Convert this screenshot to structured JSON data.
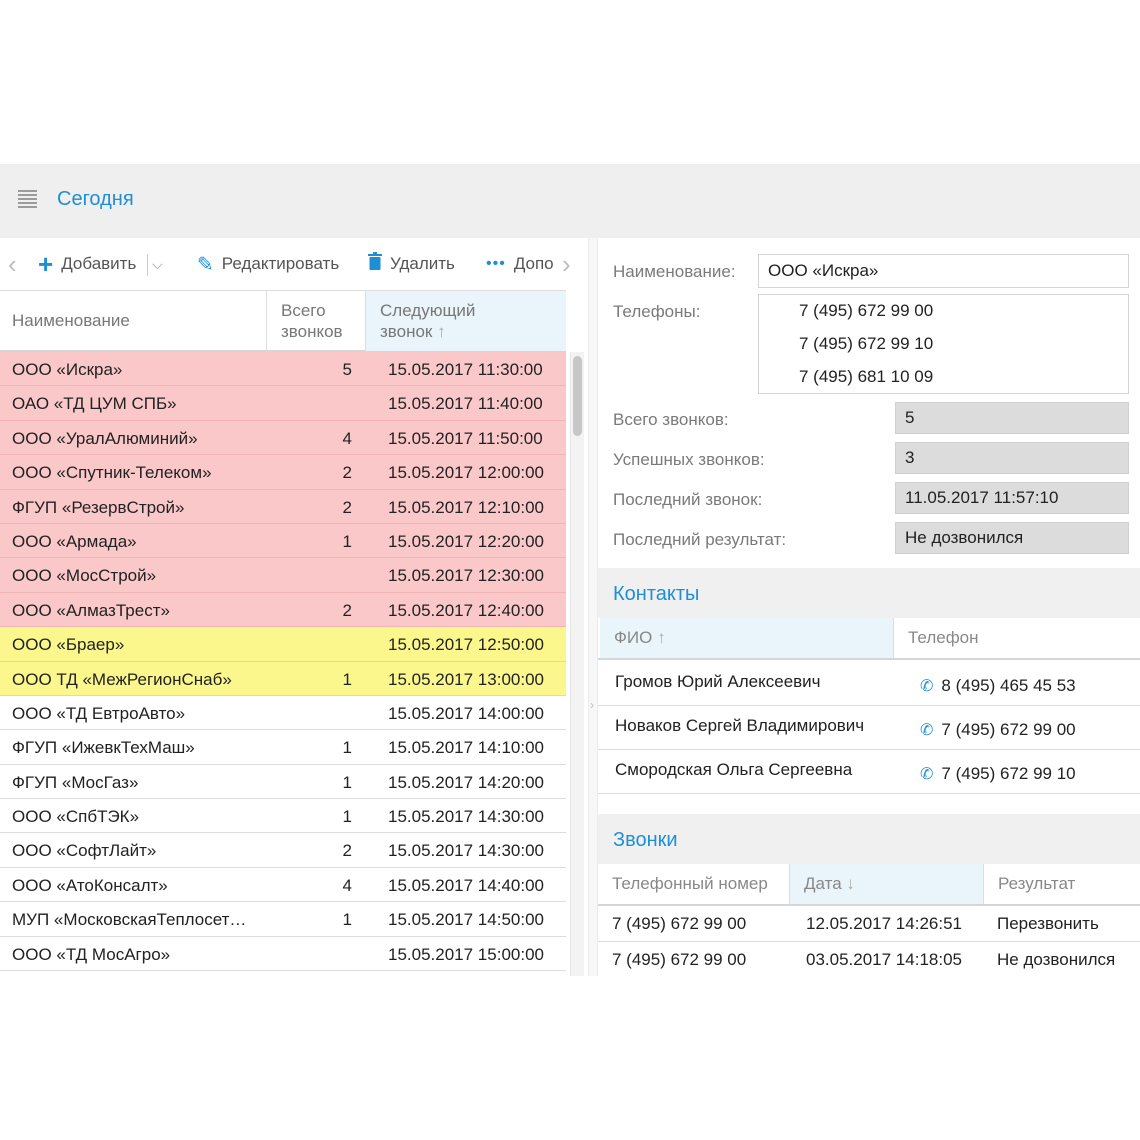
{
  "header": {
    "title": "Сегодня"
  },
  "toolbar": {
    "add_label": "Добавить",
    "edit_label": "Редактировать",
    "delete_label": "Удалить",
    "more_label": "Допо"
  },
  "list": {
    "columns": {
      "name": "Наименование",
      "total_1": "Всего",
      "total_2": "звонков",
      "next_1": "Следующий",
      "next_2": "звонок"
    },
    "rows": [
      {
        "name": "ООО «Искра»",
        "count": "5",
        "date": "15.05.2017 11:30:00",
        "status": "red"
      },
      {
        "name": "ОАО «ТД ЦУМ СПБ»",
        "count": "",
        "date": "15.05.2017 11:40:00",
        "status": "red"
      },
      {
        "name": "ООО «УралАлюминий»",
        "count": "4",
        "date": "15.05.2017 11:50:00",
        "status": "red"
      },
      {
        "name": "ООО «Спутник-Телеком»",
        "count": "2",
        "date": "15.05.2017 12:00:00",
        "status": "red"
      },
      {
        "name": "ФГУП «РезервСтрой»",
        "count": "2",
        "date": "15.05.2017 12:10:00",
        "status": "red"
      },
      {
        "name": "ООО «Армада»",
        "count": "1",
        "date": "15.05.2017 12:20:00",
        "status": "red"
      },
      {
        "name": "ООО «МосСтрой»",
        "count": "",
        "date": "15.05.2017 12:30:00",
        "status": "red"
      },
      {
        "name": "ООО «АлмазТрест»",
        "count": "2",
        "date": "15.05.2017 12:40:00",
        "status": "red"
      },
      {
        "name": "ООО «Браер»",
        "count": "",
        "date": "15.05.2017 12:50:00",
        "status": "yellow"
      },
      {
        "name": "ООО ТД «МежРегионСнаб»",
        "count": "1",
        "date": "15.05.2017 13:00:00",
        "status": "yellow"
      },
      {
        "name": "ООО «ТД ЕвтроАвто»",
        "count": "",
        "date": "15.05.2017 14:00:00",
        "status": ""
      },
      {
        "name": "ФГУП «ИжевкТехМаш»",
        "count": "1",
        "date": "15.05.2017 14:10:00",
        "status": ""
      },
      {
        "name": "ФГУП «МосГаз»",
        "count": "1",
        "date": "15.05.2017 14:20:00",
        "status": ""
      },
      {
        "name": "ООО «СпбТЭК»",
        "count": "1",
        "date": "15.05.2017 14:30:00",
        "status": ""
      },
      {
        "name": "ООО «СофтЛайт»",
        "count": "2",
        "date": "15.05.2017 14:30:00",
        "status": ""
      },
      {
        "name": "ООО «АтоКонсалт»",
        "count": "4",
        "date": "15.05.2017 14:40:00",
        "status": ""
      },
      {
        "name": "МУП «МосковскаяТеплосет…",
        "count": "1",
        "date": "15.05.2017 14:50:00",
        "status": ""
      },
      {
        "name": "ООО «ТД МосАгро»",
        "count": "",
        "date": "15.05.2017 15:00:00",
        "status": ""
      }
    ]
  },
  "detail": {
    "name_label": "Наименование:",
    "name_value": "ООО «Искра»",
    "phones_label": "Телефоны:",
    "phones": [
      "7 (495) 672 99 00",
      "7 (495) 672 99 10",
      "7 (495) 681 10 09"
    ],
    "total_label": "Всего звонков:",
    "total_value": "5",
    "success_label": "Успешных звонков:",
    "success_value": "3",
    "last_label": "Последний звонок:",
    "last_value": "11.05.2017 11:57:10",
    "result_label": "Последний результат:",
    "result_value": "Не дозвонился"
  },
  "contacts": {
    "title": "Контакты",
    "col_fio": "ФИО",
    "col_phone": "Телефон",
    "rows": [
      {
        "fio": "Громов Юрий Алексеевич",
        "phone": "8 (495) 465 45 53"
      },
      {
        "fio": "Новаков Сергей Владимирович",
        "phone": "7 (495) 672 99 00"
      },
      {
        "fio": "Смородская Ольга Сергеевна",
        "phone": "7 (495) 672 99 10"
      }
    ]
  },
  "calls": {
    "title": "Звонки",
    "col_phone": "Телефонный номер",
    "col_date": "Дата",
    "col_result": "Результат",
    "rows": [
      {
        "phone": "7 (495) 672 99 00",
        "date": "12.05.2017 14:26:51",
        "result": "Перезвонить"
      },
      {
        "phone": "7 (495) 672 99 00",
        "date": "03.05.2017 14:18:05",
        "result": "Не дозвонился"
      }
    ]
  },
  "colors": {
    "accent": "#1e8fd6",
    "overdue": "#fbc8c9",
    "soon": "#fbf78c"
  }
}
